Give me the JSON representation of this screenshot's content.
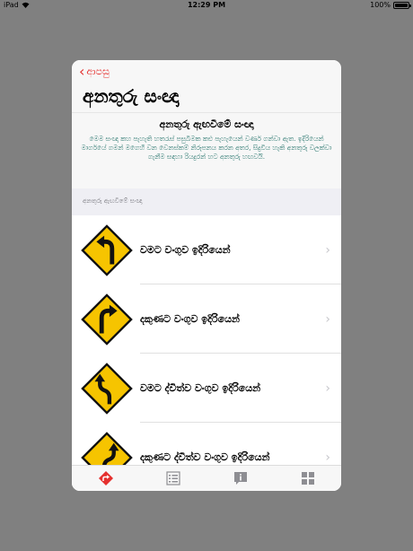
{
  "status": {
    "carrier": "iPad",
    "time": "12:29 PM",
    "battery": "100%"
  },
  "nav": {
    "back_label": "ආපසු",
    "title": "අනතුරු සංඥා"
  },
  "hero": {
    "title": "අනතුරු ඇඟවීමේ සංඥා",
    "description": "මෙම සංඥා කහ පැහැති හතරැස් පසුබිමක කළු පැහැයෙන් වර්ණ ගන්වා ඇත. ඉදිරියෙන් මාර්ගයේ ගමන් මගෙහි වන වෙනස්කම් නිරූපනය කරන අතර, සිදුවිය හැකි අනතුරු වලක්වා ගැනීම සඳහා රියදුරන් හට අනතුරු හඟවයි."
  },
  "section_header": "අනතුරු ඇඟවීමේ සංඥා",
  "items": [
    {
      "label": "වමට වංගුව ඉදිරියෙන්",
      "icon": "left-curve-sign-icon"
    },
    {
      "label": "දකුණට වංගුව ඉදිරියෙන්",
      "icon": "right-curve-sign-icon"
    },
    {
      "label": "වමට ද්විත්ව වංගුව ඉදිරියෙන්",
      "icon": "double-curve-left-sign-icon"
    },
    {
      "label": "දකුණට ද්විත්ව වංගුව ඉදිරියෙන්",
      "icon": "double-curve-right-sign-icon"
    }
  ],
  "tabs": [
    {
      "icon": "directions-icon",
      "active": true
    },
    {
      "icon": "list-icon",
      "active": false
    },
    {
      "icon": "info-icon",
      "active": false
    },
    {
      "icon": "grid-icon",
      "active": false
    }
  ],
  "colors": {
    "accent": "#e5302e",
    "sign_yellow": "#f6c400",
    "description_text": "#2f7a72"
  }
}
